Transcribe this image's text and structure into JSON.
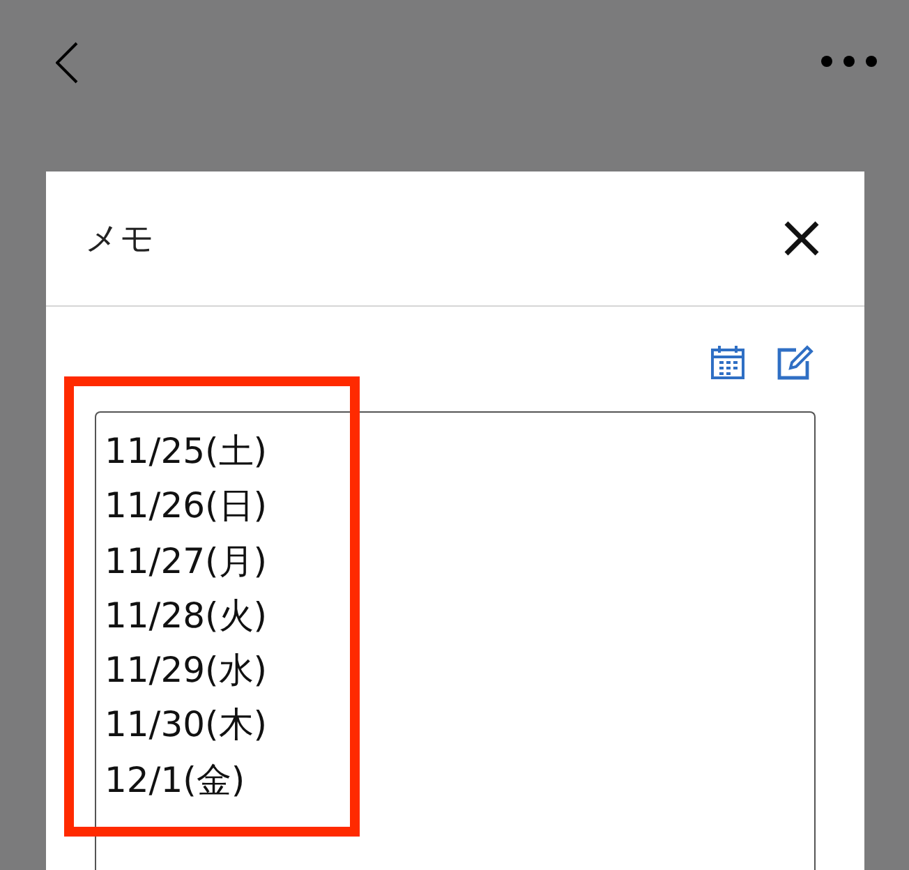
{
  "dialog": {
    "title": "メモ",
    "memo": {
      "lines": [
        "11/25(土)",
        "11/26(日)",
        "11/27(月)",
        "11/28(火)",
        "11/29(水)",
        "11/30(木)",
        "12/1(金)"
      ]
    },
    "highlight": {
      "color": "#ff2a00"
    }
  }
}
